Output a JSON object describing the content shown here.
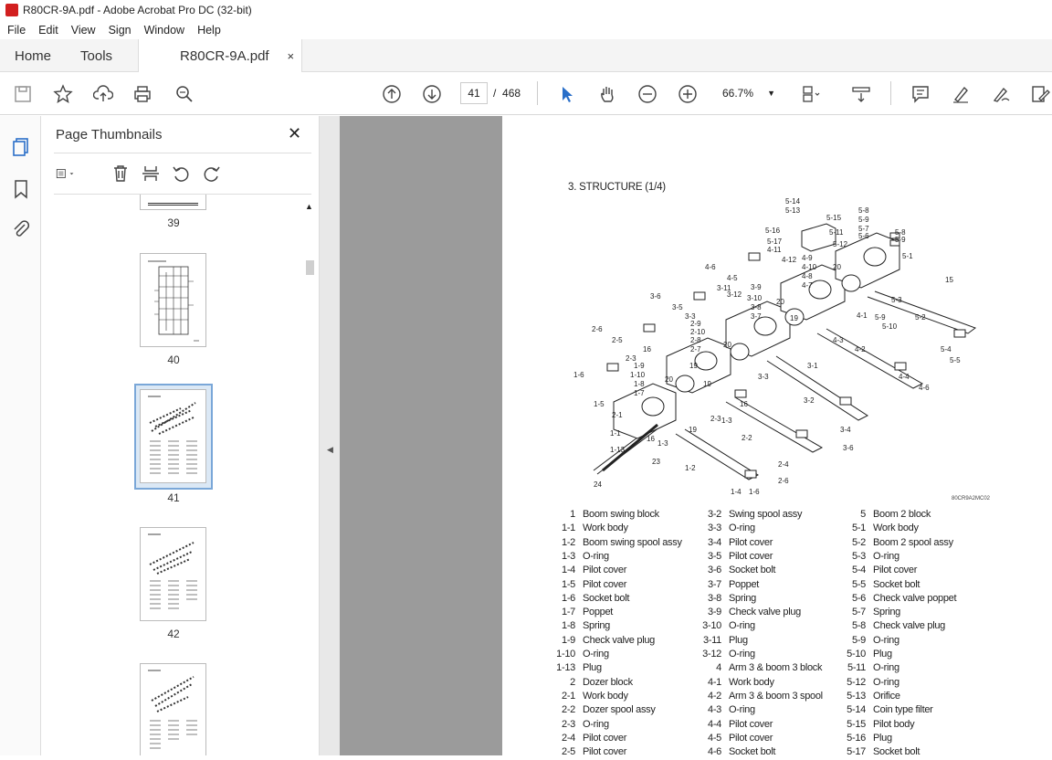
{
  "window": {
    "title": "R80CR-9A.pdf - Adobe Acrobat Pro DC (32-bit)"
  },
  "menu": [
    "File",
    "Edit",
    "View",
    "Sign",
    "Window",
    "Help"
  ],
  "tabs": {
    "home": "Home",
    "tools": "Tools",
    "doc": "R80CR-9A.pdf",
    "close": "×"
  },
  "toolbar": {
    "page_current": "41",
    "page_sep": "/",
    "page_total": "468",
    "zoom": "66.7%"
  },
  "panel": {
    "title": "Page Thumbnails",
    "close": "✕",
    "thumbs": [
      {
        "label": "39"
      },
      {
        "label": "40"
      },
      {
        "label": "41"
      },
      {
        "label": "42"
      }
    ]
  },
  "document": {
    "heading": "3. STRUCTURE (1/4)",
    "figure_code": "80CR9A2MC02",
    "diagram_labels": [
      "5-14",
      "5-13",
      "5-15",
      "5-16",
      "5-11",
      "5-17",
      "5-12",
      "4-11",
      "4-12",
      "5-8",
      "5-9",
      "5-7",
      "5-6",
      "5-8",
      "5-9",
      "5-1",
      "4-9",
      "4-10",
      "4-8",
      "4-7",
      "4-6",
      "4-5",
      "20",
      "15",
      "3-11",
      "3-12",
      "3-9",
      "3-10",
      "3-8",
      "3-7",
      "20",
      "19",
      "5-3",
      "4-1",
      "5-2",
      "3-6",
      "3-5",
      "3-3",
      "5-9",
      "5-10",
      "2-9",
      "2-10",
      "2-8",
      "2-7",
      "20",
      "4-3",
      "4-2",
      "2-6",
      "2-5",
      "16",
      "19",
      "5-4",
      "5-5",
      "1-6",
      "2-3",
      "19",
      "3-1",
      "4-4",
      "4-6",
      "1-9",
      "1-10",
      "1-8",
      "1-7",
      "20",
      "3-3",
      "3-2",
      "1-5",
      "16",
      "2-1",
      "1-3",
      "19",
      "1-1",
      "3-4",
      "2-3",
      "3-6",
      "16",
      "2-2",
      "1-13",
      "23",
      "1-3",
      "2-4",
      "1-2",
      "2-6",
      "24",
      "1-4",
      "1-6"
    ],
    "parts": [
      [
        {
          "n": "1",
          "name": "Boom swing block"
        },
        {
          "n": "1-1",
          "name": "Work body"
        },
        {
          "n": "1-2",
          "name": "Boom swing spool assy"
        },
        {
          "n": "1-3",
          "name": "O-ring"
        },
        {
          "n": "1-4",
          "name": "Pilot cover"
        },
        {
          "n": "1-5",
          "name": "Pilot cover"
        },
        {
          "n": "1-6",
          "name": "Socket bolt"
        },
        {
          "n": "1-7",
          "name": "Poppet"
        },
        {
          "n": "1-8",
          "name": "Spring"
        },
        {
          "n": "1-9",
          "name": "Check valve plug"
        },
        {
          "n": "1-10",
          "name": "O-ring"
        },
        {
          "n": "1-13",
          "name": "Plug"
        },
        {
          "n": "2",
          "name": "Dozer block"
        },
        {
          "n": "2-1",
          "name": "Work body"
        },
        {
          "n": "2-2",
          "name": "Dozer spool assy"
        },
        {
          "n": "2-3",
          "name": "O-ring"
        },
        {
          "n": "2-4",
          "name": "Pilot cover"
        },
        {
          "n": "2-5",
          "name": "Pilot cover"
        }
      ],
      [
        {
          "n": "3-2",
          "name": "Swing spool assy"
        },
        {
          "n": "3-3",
          "name": "O-ring"
        },
        {
          "n": "3-4",
          "name": "Pilot cover"
        },
        {
          "n": "3-5",
          "name": "Pilot cover"
        },
        {
          "n": "3-6",
          "name": "Socket bolt"
        },
        {
          "n": "3-7",
          "name": "Poppet"
        },
        {
          "n": "3-8",
          "name": "Spring"
        },
        {
          "n": "3-9",
          "name": "Check valve plug"
        },
        {
          "n": "3-10",
          "name": "O-ring"
        },
        {
          "n": "3-11",
          "name": "Plug"
        },
        {
          "n": "3-12",
          "name": "O-ring"
        },
        {
          "n": "4",
          "name": "Arm 3 & boom 3 block"
        },
        {
          "n": "4-1",
          "name": "Work body"
        },
        {
          "n": "4-2",
          "name": "Arm 3 & boom 3 spool"
        },
        {
          "n": "4-3",
          "name": "O-ring"
        },
        {
          "n": "4-4",
          "name": "Pilot cover"
        },
        {
          "n": "4-5",
          "name": "Pilot cover"
        },
        {
          "n": "4-6",
          "name": "Socket bolt"
        }
      ],
      [
        {
          "n": "5",
          "name": "Boom 2 block"
        },
        {
          "n": "5-1",
          "name": "Work body"
        },
        {
          "n": "5-2",
          "name": "Boom 2 spool assy"
        },
        {
          "n": "5-3",
          "name": "O-ring"
        },
        {
          "n": "5-4",
          "name": "Pilot cover"
        },
        {
          "n": "5-5",
          "name": "Socket bolt"
        },
        {
          "n": "5-6",
          "name": "Check valve poppet"
        },
        {
          "n": "5-7",
          "name": "Spring"
        },
        {
          "n": "5-8",
          "name": "Check valve plug"
        },
        {
          "n": "5-9",
          "name": "O-ring"
        },
        {
          "n": "5-10",
          "name": "Plug"
        },
        {
          "n": "5-11",
          "name": "O-ring"
        },
        {
          "n": "5-12",
          "name": "O-ring"
        },
        {
          "n": "5-13",
          "name": "Orifice"
        },
        {
          "n": "5-14",
          "name": "Coin type filter"
        },
        {
          "n": "5-15",
          "name": "Pilot body"
        },
        {
          "n": "5-16",
          "name": "Plug"
        },
        {
          "n": "5-17",
          "name": "Socket bolt"
        }
      ]
    ]
  }
}
